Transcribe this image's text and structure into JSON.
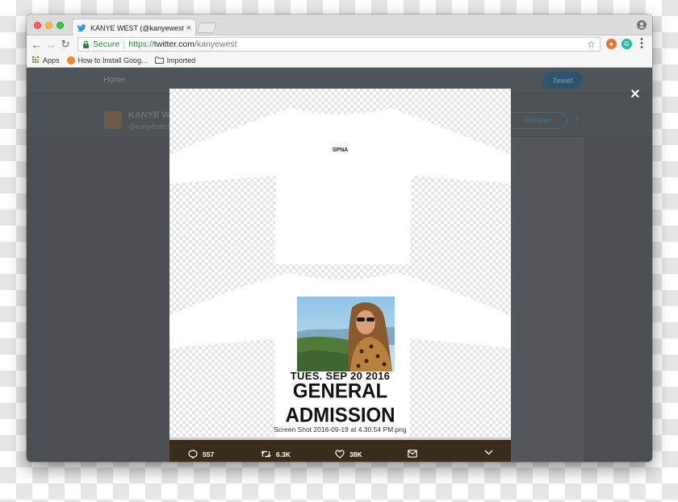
{
  "browser": {
    "tab_title": "KANYE WEST (@kanyewest) | T",
    "tab_close": "×",
    "secure_label": "Secure",
    "url_scheme": "https://",
    "url_host": "twitter.com",
    "url_path": "/kanyewest",
    "bookmarks": [
      {
        "label": "Apps"
      },
      {
        "label": "How to Install Goog..."
      },
      {
        "label": "Imported"
      }
    ]
  },
  "twitter_page": {
    "nav_home": "Home",
    "tweet_button": "Tweet",
    "profile_name": "KANYE WE",
    "profile_handle": "@kanyewest",
    "follow_button": "Follow"
  },
  "modal": {
    "close": "×",
    "shirt_label": "SPNA",
    "event_date": "TUES. SEP 20 2016",
    "event_line1": "GENERAL",
    "event_line2": "ADMISSION",
    "caption": "Screen Shot 2016-09-19 at 4.30.54 PM.png",
    "replies": "557",
    "retweets": "6.3K",
    "likes": "38K"
  },
  "colors": {
    "twitter_blue": "#1da1f2",
    "secure_green": "#1e8e3e",
    "action_bar": "#3a2c1c"
  }
}
